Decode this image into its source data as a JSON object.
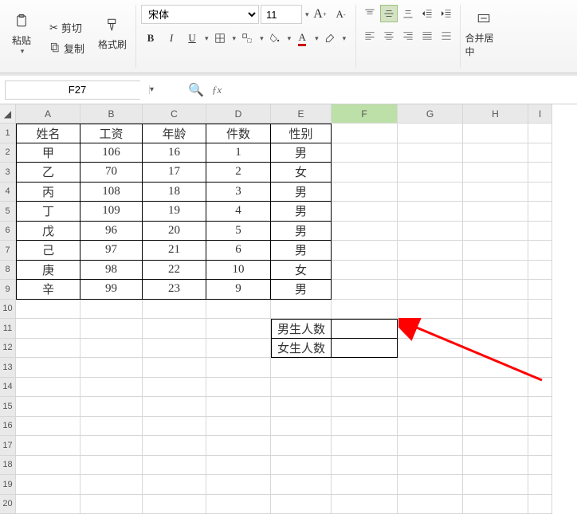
{
  "ribbon": {
    "paste": "粘贴",
    "cut": "剪切",
    "copy": "复制",
    "fmtpainter": "格式刷",
    "font_name": "宋体",
    "font_size": "11",
    "merge": "合并居中"
  },
  "namebox": "F27",
  "sheet": {
    "cols": [
      "A",
      "B",
      "C",
      "D",
      "E",
      "F",
      "G",
      "H",
      "I"
    ],
    "active_col": "F",
    "header": [
      "姓名",
      "工资",
      "年龄",
      "件数",
      "性别"
    ],
    "rows": [
      [
        "甲",
        "106",
        "16",
        "1",
        "男"
      ],
      [
        "乙",
        "70",
        "17",
        "2",
        "女"
      ],
      [
        "丙",
        "108",
        "18",
        "3",
        "男"
      ],
      [
        "丁",
        "109",
        "19",
        "4",
        "男"
      ],
      [
        "戊",
        "96",
        "20",
        "5",
        "男"
      ],
      [
        "己",
        "97",
        "21",
        "6",
        "男"
      ],
      [
        "庚",
        "98",
        "22",
        "10",
        "女"
      ],
      [
        "辛",
        "99",
        "23",
        "9",
        "男"
      ]
    ],
    "summary_row1": "男生人数",
    "summary_row2": "女生人数",
    "summary_v1": "",
    "summary_v2": ""
  },
  "chart_data": {
    "type": "table",
    "title": "",
    "columns": [
      "姓名",
      "工资",
      "年龄",
      "件数",
      "性别"
    ],
    "rows": [
      [
        "甲",
        106,
        16,
        1,
        "男"
      ],
      [
        "乙",
        70,
        17,
        2,
        "女"
      ],
      [
        "丙",
        108,
        18,
        3,
        "男"
      ],
      [
        "丁",
        109,
        19,
        4,
        "男"
      ],
      [
        "戊",
        96,
        20,
        5,
        "男"
      ],
      [
        "己",
        97,
        21,
        6,
        "男"
      ],
      [
        "庚",
        98,
        22,
        10,
        "女"
      ],
      [
        "辛",
        99,
        23,
        9,
        "男"
      ]
    ],
    "summary": [
      {
        "label": "男生人数",
        "value": null
      },
      {
        "label": "女生人数",
        "value": null
      }
    ]
  }
}
